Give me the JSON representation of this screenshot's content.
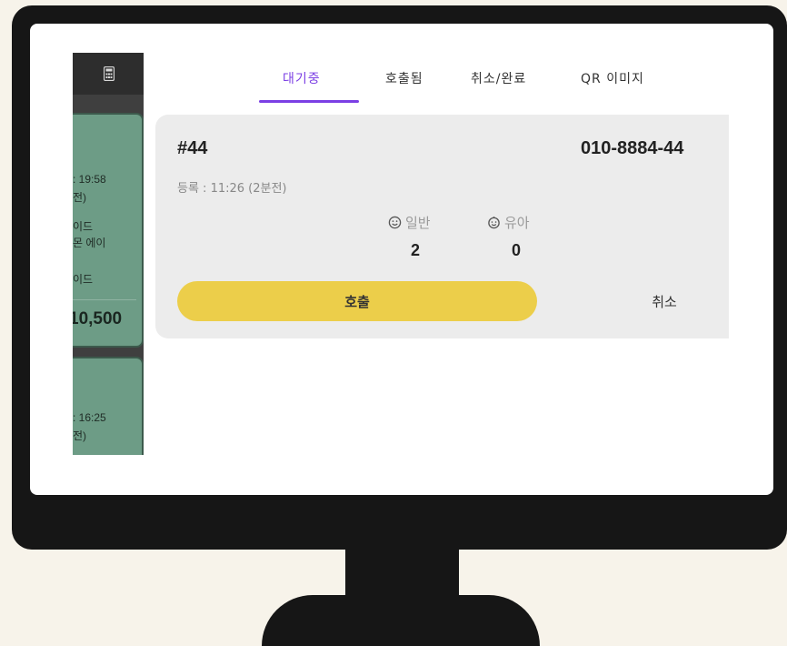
{
  "sidebar": {
    "card1": {
      "time": ": 19:58",
      "ago": "전)",
      "line1": "이드",
      "line2": "몬 에이",
      "line3": "이드",
      "price": "10,500"
    },
    "card2": {
      "time": ": 16:25",
      "ago": "전)"
    }
  },
  "tabs": [
    {
      "label": "대기중",
      "active": true
    },
    {
      "label": "호출됨",
      "active": false
    },
    {
      "label": "취소/완료",
      "active": false
    },
    {
      "label": "QR 이미지",
      "active": false
    }
  ],
  "waiting": {
    "number": "#44",
    "phone": "010-8884-44",
    "registered": "등록 : 11:26 (2분전)",
    "general_label": "일반",
    "general_count": "2",
    "infant_label": "유아",
    "infant_count": "0",
    "call_label": "호출",
    "cancel_label": "취소"
  },
  "colors": {
    "accent": "#7b3fe4",
    "call_button": "#ecce4a",
    "sidebar_card": "#6d9c86",
    "monitor": "#161616"
  }
}
